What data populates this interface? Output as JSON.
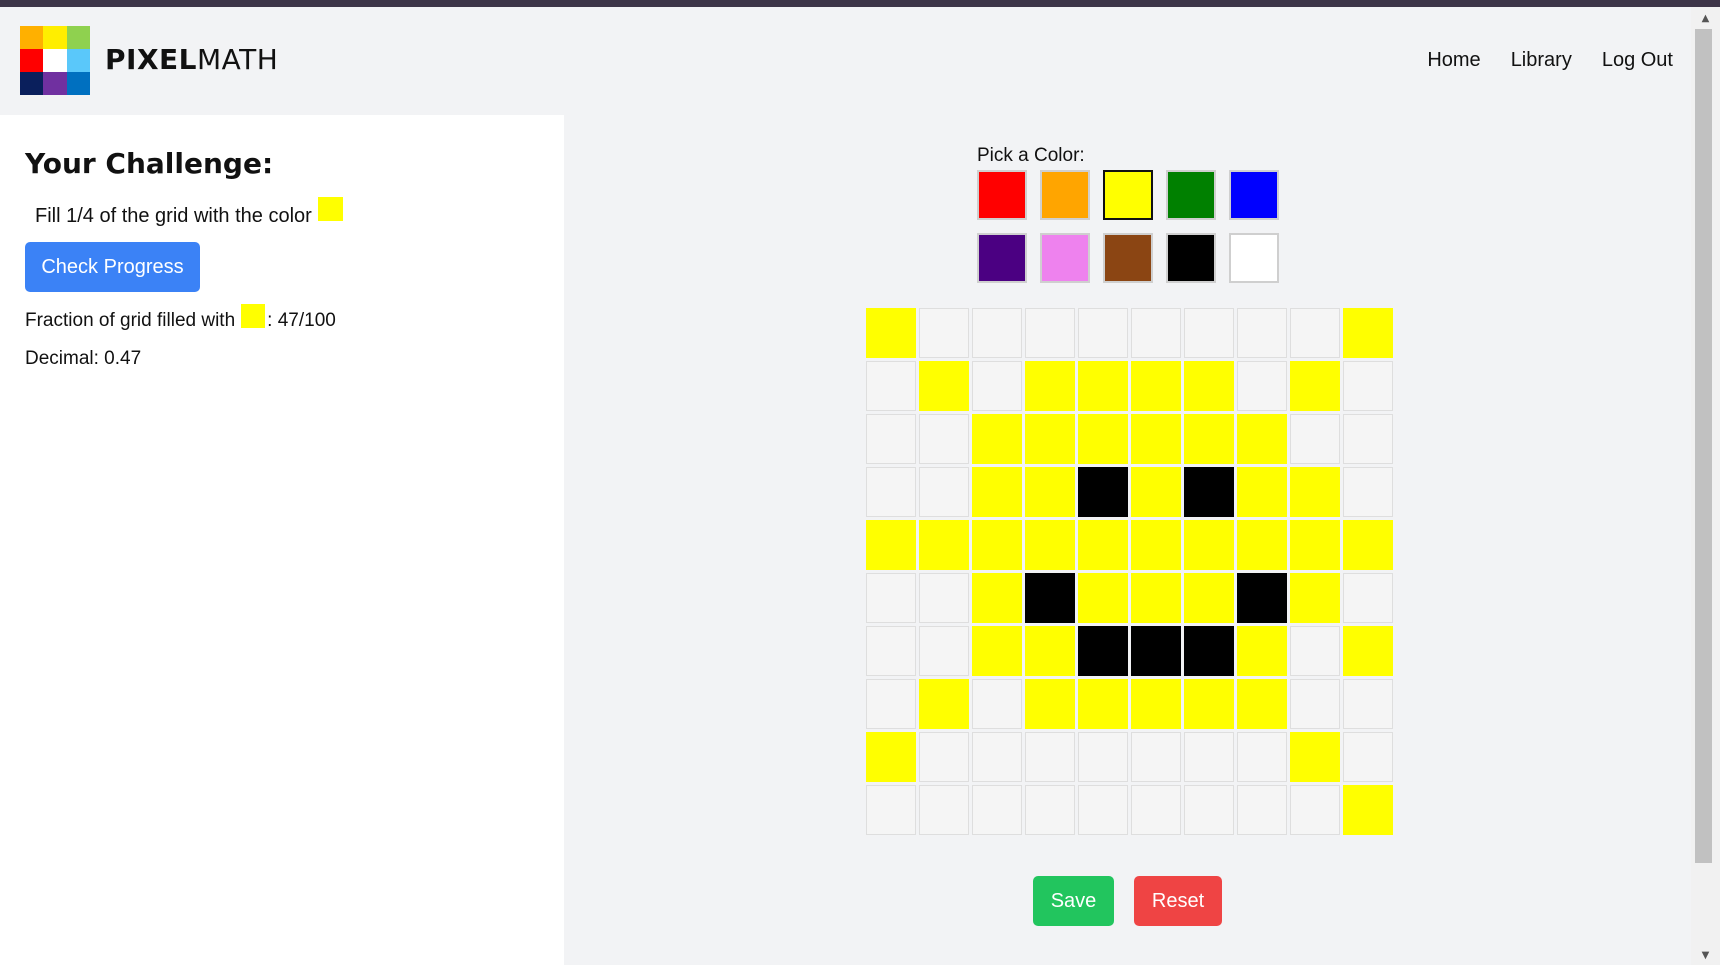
{
  "header": {
    "brand_bold": "PIXEL",
    "brand_light": "MATH",
    "logo_colors": [
      "#ffb000",
      "#ffee00",
      "#8fd14f",
      "#ff0000",
      "#ffffff",
      "#5ac8fa",
      "#0a1f5c",
      "#7030a0",
      "#0070c0"
    ],
    "nav": [
      {
        "label": "Home"
      },
      {
        "label": "Library"
      },
      {
        "label": "Log Out"
      }
    ]
  },
  "challenge": {
    "title": "Your Challenge:",
    "text": "Fill 1/4 of the grid with the color",
    "target_color": "#ffff00",
    "check_label": "Check Progress",
    "fraction_label": "Fraction of grid filled with",
    "fraction_value": ": 47/100",
    "decimal_text": "Decimal: 0.47"
  },
  "palette": {
    "label": "Pick a Color:",
    "colors": [
      "#ff0000",
      "#ffa500",
      "#ffff00",
      "#008000",
      "#0000ff",
      "#4b0082",
      "#ee82ee",
      "#8b4513",
      "#000000",
      "#ffffff"
    ],
    "selected_index": 2
  },
  "grid": {
    "empty_color": "#f5f5f5",
    "color_map": {
      "Y": "#ffff00",
      "B": "#000000",
      ".": "#f5f5f5"
    },
    "rows": [
      "Y........Y",
      ".Y.YYYY.Y.",
      "..YYYYYY..",
      "..YYBYBYY.",
      "YYYYYYYYYY",
      "..YBYYYBY.",
      "..YYBBBY.Y",
      ".Y.YYYYY..",
      "Y.......Y.",
      ".........Y"
    ]
  },
  "actions": {
    "save_label": "Save",
    "reset_label": "Reset"
  }
}
